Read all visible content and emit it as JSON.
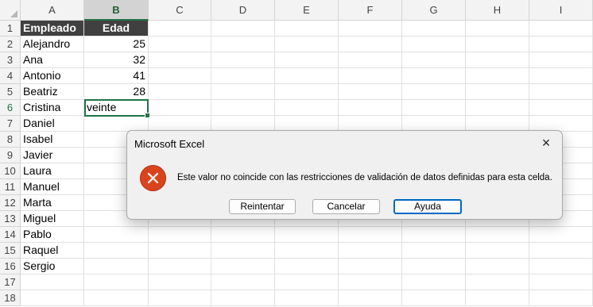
{
  "columns": [
    "A",
    "B",
    "C",
    "D",
    "E",
    "F",
    "G",
    "H",
    "I"
  ],
  "selected_column": "B",
  "rows": [
    "1",
    "2",
    "3",
    "4",
    "5",
    "6",
    "7",
    "8",
    "9",
    "10",
    "11",
    "12",
    "13",
    "14",
    "15",
    "16",
    "17",
    "18"
  ],
  "selected_row": "6",
  "table": {
    "headers": [
      "Empleado",
      "Edad"
    ],
    "data": [
      {
        "name": "Alejandro",
        "age": "25"
      },
      {
        "name": "Ana",
        "age": "32"
      },
      {
        "name": "Antonio",
        "age": "41"
      },
      {
        "name": "Beatriz",
        "age": "28"
      },
      {
        "name": "Cristina",
        "age": "veinte"
      },
      {
        "name": "Daniel",
        "age": ""
      },
      {
        "name": "Isabel",
        "age": ""
      },
      {
        "name": "Javier",
        "age": ""
      },
      {
        "name": "Laura",
        "age": ""
      },
      {
        "name": "Manuel",
        "age": ""
      },
      {
        "name": "Marta",
        "age": ""
      },
      {
        "name": "Miguel",
        "age": ""
      },
      {
        "name": "Pablo",
        "age": ""
      },
      {
        "name": "Raquel",
        "age": ""
      },
      {
        "name": "Sergio",
        "age": ""
      }
    ]
  },
  "dialog": {
    "title": "Microsoft Excel",
    "close_icon": "×",
    "icon": "error-icon",
    "message": "Este valor no coincide con las restricciones de validación de datos definidas para esta celda.",
    "buttons": {
      "retry": "Reintentar",
      "cancel": "Cancelar",
      "help": "Ayuda"
    }
  },
  "colors": {
    "accent": "#217346",
    "header_fill": "#404040",
    "error": "#d9441f",
    "default_button": "#0067c0"
  }
}
